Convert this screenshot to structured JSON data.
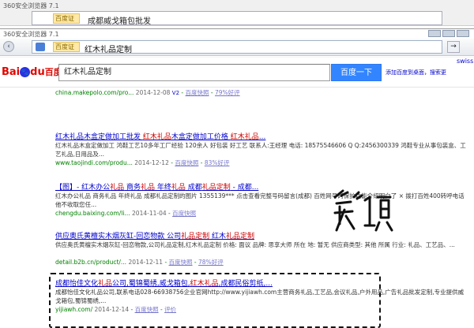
{
  "ghost_window": {
    "title": "360安全浏览器 7.1",
    "security_label": "百度",
    "security_badge": "证",
    "url": "成都威戈箱包批发"
  },
  "window": {
    "title": "360安全浏览器 7.1",
    "security_label": "百度",
    "security_badge": "证",
    "url": "红木礼品定制",
    "go_glyph": "→"
  },
  "bookmarks": [
    {
      "label": "手机收藏夹",
      "color": "#3a7bd5"
    },
    {
      "label": "非成都市",
      "color": "#e07b00"
    },
    {
      "label": "百度",
      "color": "#2932e1"
    },
    {
      "label": "武侯区恰",
      "color": "#e14a2b"
    },
    {
      "label": "百度一恰",
      "color": "#2932e1"
    },
    {
      "label": "百度搜索",
      "color": "#2932e1"
    },
    {
      "label": "Microsof",
      "color": "#f2b43a"
    },
    {
      "label": "root",
      "color": "#f2b43a"
    },
    {
      "label": "UTC分销",
      "color": "#f2b43a"
    },
    {
      "label": "UTC行家",
      "color": "#f2b43a"
    },
    {
      "label": "促销礼品",
      "color": "#f2b43a"
    }
  ],
  "tabs": [
    {
      "label": "360",
      "color": "#27a844",
      "active": false
    },
    {
      "label": "红",
      "color": "#2932e1",
      "active": true
    },
    {
      "label": "知",
      "color": "#2932e1",
      "active": false
    },
    {
      "label": "yij",
      "color": "#888888",
      "active": false
    },
    {
      "label": "导",
      "color": "#2932e1",
      "active": false
    },
    {
      "label": "网",
      "color": "#2932e1",
      "active": false
    },
    {
      "label": "全",
      "color": "#2932e1",
      "active": false
    },
    {
      "label": "网",
      "color": "#2932e1",
      "active": false
    },
    {
      "label": "百",
      "color": "#2932e1",
      "active": false
    },
    {
      "label": "网",
      "color": "#2932e1",
      "active": false
    },
    {
      "label": "成",
      "color": "#e14a2b",
      "active": false
    },
    {
      "label": "管",
      "color": "#e14a2b",
      "active": false
    },
    {
      "label": "网",
      "color": "#2932e1",
      "active": false
    }
  ],
  "baidu": {
    "logo_bai": "Bai",
    "logo_du": "du",
    "logo_cn": "百度",
    "query": "红木礼品定制",
    "search_button": "百度一下",
    "header_links": "添加百度到桌面，搜索更",
    "corner_text": "swiss"
  },
  "results": [
    {
      "title": "",
      "desc": "",
      "url": "china.makepolo.com/pro...",
      "date": "2014-12-08",
      "v2": "V2",
      "snapshot": "百度快照",
      "rating": "79%好评"
    },
    {
      "title_parts": [
        "红木礼品木盒定做加工批发 ",
        "红木礼品",
        "木盒定做加工价格 ",
        "红木礼品",
        "..."
      ],
      "desc": "红木礼品木盒定做加工 鸿鞋工艺10多年工厂经验 120余人 好包装 好工艺 联系人:王经理 电话: 18575546606 Q Q:2456300339 鸿鞋专业从事包装盒、工艺礼品,日用品及...",
      "url": "www.taojindi.com/produ...",
      "date": "2014-12-12",
      "snapshot": "百度快照",
      "rating": "83%好评"
    },
    {
      "title_parts": [
        "【图】- 红木办公",
        "礼品",
        " 商务",
        "礼品",
        " 年终",
        "礼品",
        " 成都",
        "礼品定制",
        " - 成都..."
      ],
      "desc": "红木办公礼品 商务礼品 年终礼品 成都礼品定制的图片 1355139*** 点击查看完整号码留言(成都) 百姓网号码保护功能介绍明白了 × 拨打百姓400转呼电话他不收取您任...",
      "url": "chengdu.baixing.com/li...",
      "date": "2014-11-04",
      "snapshot": "百度快照"
    },
    {
      "title_parts": [
        "供应奥氏黄檀实木烟灰缸-回恋物款 公司",
        "礼品定制",
        " 红木",
        "礼品定制"
      ],
      "desc": "供应奥氏黄檀实木烟灰缸-回恋物款,公司礼品定制,红木礼品定制 价格: 面议 品牌: 思享大师 所在 地: 暂无 供应商类型: 其他 所属 行业: 礼品、工艺品、...",
      "url": "detail.b2b.cn/product/...",
      "date": "2014-12-11",
      "snapshot": "百度快照",
      "rating": "78%好评"
    },
    {
      "title_parts": [
        "成都怡佳文化",
        "礼品",
        "公司,蜀锦蜀绣,威戈箱包,",
        "红木礼品",
        ",成都民俗剪纸,..."
      ],
      "desc": "成都怡佳文化礼品公司,联系电话028-66938756企业官网http://www.yijiawh.com主营商务礼品,工艺品,会议礼品,户外用品,广告礼品批发定制,专业提供威戈箱包,蜀锦蜀绣,...",
      "url": "yijiawh.com/",
      "date": "2014-12-14",
      "snapshot": "百度快照",
      "rating": "评价"
    }
  ],
  "handwriting": {
    "text": "第1页"
  }
}
